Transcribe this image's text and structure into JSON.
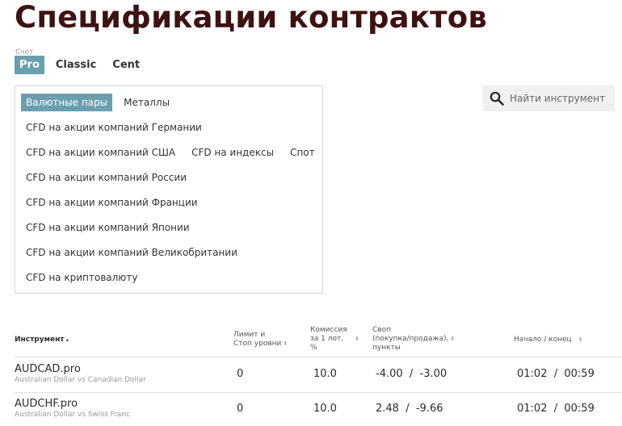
{
  "page": {
    "title": "Спецификации контрактов"
  },
  "account": {
    "caption": "Счет",
    "tabs": [
      "Pro",
      "Classic",
      "Cent"
    ],
    "active": "Pro"
  },
  "categories": {
    "active": "Валютные пары",
    "rows": [
      [
        "Валютные пары",
        "Металлы"
      ],
      [
        "CFD на акции компаний Германии"
      ],
      [
        "CFD на акции компаний США",
        "CFD на индексы",
        "Спот"
      ],
      [
        "CFD на акции компаний России"
      ],
      [
        "CFD на акции компаний Франции"
      ],
      [
        "CFD на акции компаний Японии"
      ],
      [
        "CFD на акции компаний Великобритании"
      ],
      [
        "CFD на криптовалюту"
      ]
    ]
  },
  "search": {
    "placeholder": "Найти инструмент",
    "icon": "search-icon"
  },
  "table": {
    "headers": {
      "instrument": "Инструмент",
      "limit_l1": "Лимит и",
      "limit_l2": "Стоп уровни",
      "commission_l1": "Комиссия",
      "commission_l2": "за 1 лот,",
      "commission_l3": "%",
      "swap_l1": "Своп",
      "swap_l2": "(покупка/продажа),",
      "swap_l3": "пункты",
      "time": "Начало / конец"
    },
    "rows": [
      {
        "symbol": "AUDCAD.pro",
        "description": "Australian Dollar vs Canadian Dollar",
        "limit": "0",
        "commission": "10.0",
        "swap": "-4.00  /  -3.00",
        "time": "01:02  /  00:59"
      },
      {
        "symbol": "AUDCHF.pro",
        "description": "Australian Dollar vs Swiss Franc",
        "limit": "0",
        "commission": "10.0",
        "swap": "2.48  /  -9.66",
        "time": "01:02  /  00:59"
      }
    ]
  }
}
